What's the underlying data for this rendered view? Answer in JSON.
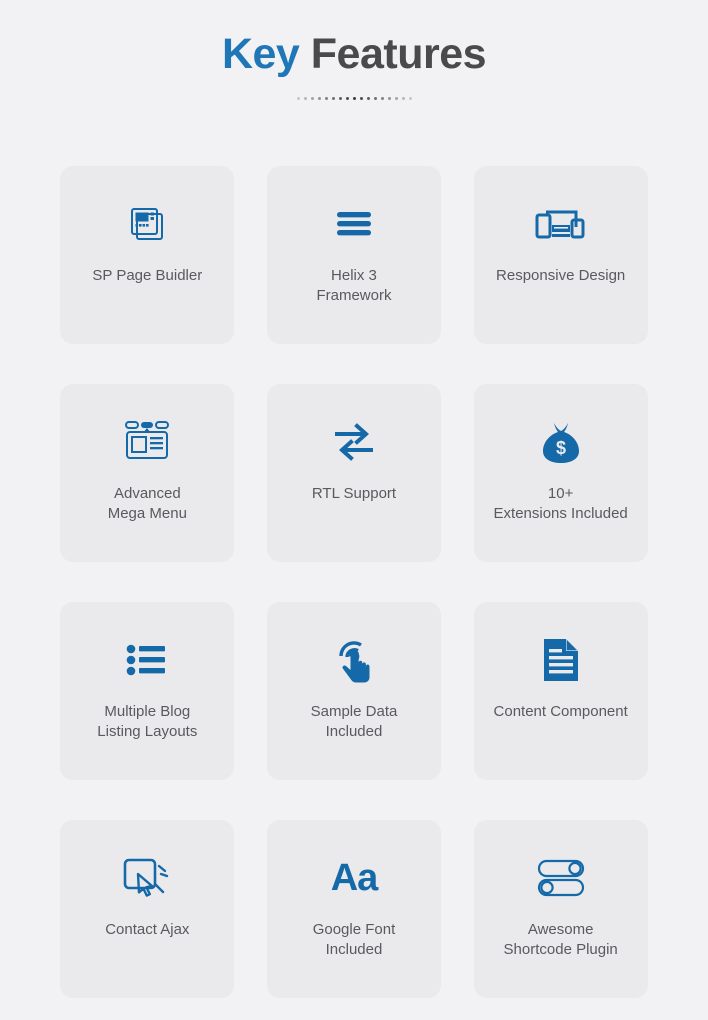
{
  "header": {
    "title_accent": "Key",
    "title_rest": " Features",
    "dot_count": 17
  },
  "colors": {
    "page_background": "#f2f2f4",
    "card_background": "#eaeaec",
    "accent_blue": "#1669a8",
    "title_blue": "#1f77b8",
    "label_gray": "#595a5e"
  },
  "features": [
    {
      "label": "SP Page Buidler",
      "icon": "page-builder-icon",
      "rows": 1
    },
    {
      "label": "Helix 3\nFramework",
      "icon": "hamburger-menu-icon",
      "rows": 2
    },
    {
      "label": "Responsive Design",
      "icon": "responsive-devices-icon",
      "rows": 1
    },
    {
      "label": "Advanced\nMega Menu",
      "icon": "mega-menu-icon",
      "rows": 2
    },
    {
      "label": "RTL Support",
      "icon": "exchange-arrows-icon",
      "rows": 1
    },
    {
      "label": "10+\nExtensions Included",
      "icon": "money-bag-icon",
      "rows": 2
    },
    {
      "label": "Multiple Blog\nListing Layouts",
      "icon": "bullet-list-icon",
      "rows": 2
    },
    {
      "label": "Sample Data\nIncluded",
      "icon": "tap-hand-icon",
      "rows": 2
    },
    {
      "label": "Content Component",
      "icon": "document-icon",
      "rows": 1
    },
    {
      "label": "Contact Ajax",
      "icon": "click-cursor-icon",
      "rows": 1
    },
    {
      "label": "Google Font\nIncluded",
      "icon": "typography-aa-icon",
      "rows": 2
    },
    {
      "label": "Awesome\nShortcode Plugin",
      "icon": "toggle-switches-icon",
      "rows": 2
    }
  ],
  "icon_text": {
    "aa": "Aa"
  }
}
